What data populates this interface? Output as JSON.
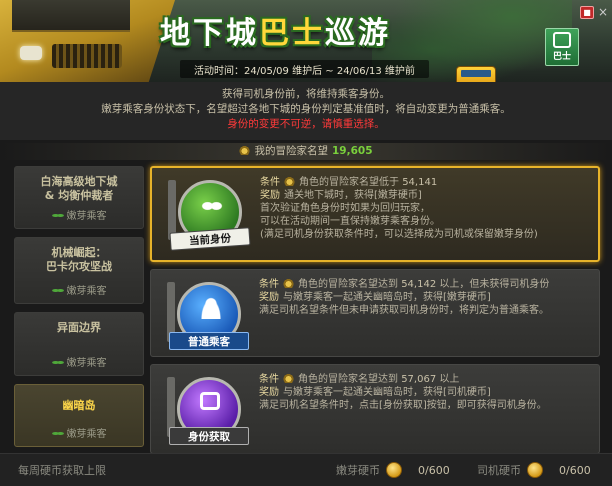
{
  "header": {
    "title_part1": "地下城",
    "title_part2": "巴士",
    "title_part3": "巡游",
    "activity_time": "活动时间：24/05/09 维护后 ~ 24/06/13 维护前",
    "side_button_label": "巴士"
  },
  "notice": {
    "line1": "获得司机身份前，将维持乘客身份。",
    "line2": "嫩芽乘客身份状态下，名望超过各地下城的身份判定基准值时，将自动变更为普通乘客。",
    "line3": "身份的变更不可逆，请慎重选择。"
  },
  "reputation": {
    "label": "我的冒险家名望",
    "value": "19,605"
  },
  "tabs": [
    {
      "name": "白海高级地下城\n& 均衡仲裁者",
      "sub": "嫩芽乘客",
      "active": false
    },
    {
      "name": "机械崛起：\n巴卡尔攻坚战",
      "sub": "嫩芽乘客",
      "active": false
    },
    {
      "name": "异面边界",
      "sub": "嫩芽乘客",
      "active": false
    },
    {
      "name": "幽暗岛",
      "sub": "嫩芽乘客",
      "active": true
    }
  ],
  "tiers": [
    {
      "badge": "当前身份",
      "color": "green",
      "cond_key": "条件",
      "cond": "角色的冒险家名望低于",
      "cond_num": "54,141",
      "reward_key": "奖励",
      "reward": "通关地下城时，获得[嫩芽硬币]",
      "extra": [
        "首次验证角色身份时如果为回归玩家，",
        "可以在活动期间一直保持嫩芽乘客身份。",
        "(满足司机身份获取条件时，可以选择成为司机或保留嫩芽身份)"
      ]
    },
    {
      "badge": "普通乘客",
      "color": "blue",
      "cond_key": "条件",
      "cond": "角色的冒险家名望达到",
      "cond_num": "54,142",
      "cond_tail": "以上，但未获得司机身份",
      "reward_key": "奖励",
      "reward": "与嫩芽乘客一起通关幽暗岛时，获得[嫩芽硬币]",
      "extra": [
        "满足司机名望条件但未申请获取司机身份时，将判定为普通乘客。"
      ]
    },
    {
      "badge": "身份获取",
      "color": "purple",
      "cond_key": "条件",
      "cond": "角色的冒险家名望达到",
      "cond_num": "57,067",
      "cond_tail": "以上",
      "reward_key": "奖励",
      "reward": "与嫩芽乘客一起通关幽暗岛时，获得[司机硬币]",
      "extra": [
        "满足司机名望条件时，点击[身份获取]按钮，即可获得司机身份。"
      ]
    }
  ],
  "footer": {
    "weekly_label": "每周硬币获取上限",
    "sprout_coin_label": "嫩芽硬币",
    "sprout_coin_value": "0/600",
    "driver_coin_label": "司机硬币",
    "driver_coin_value": "0/600"
  }
}
